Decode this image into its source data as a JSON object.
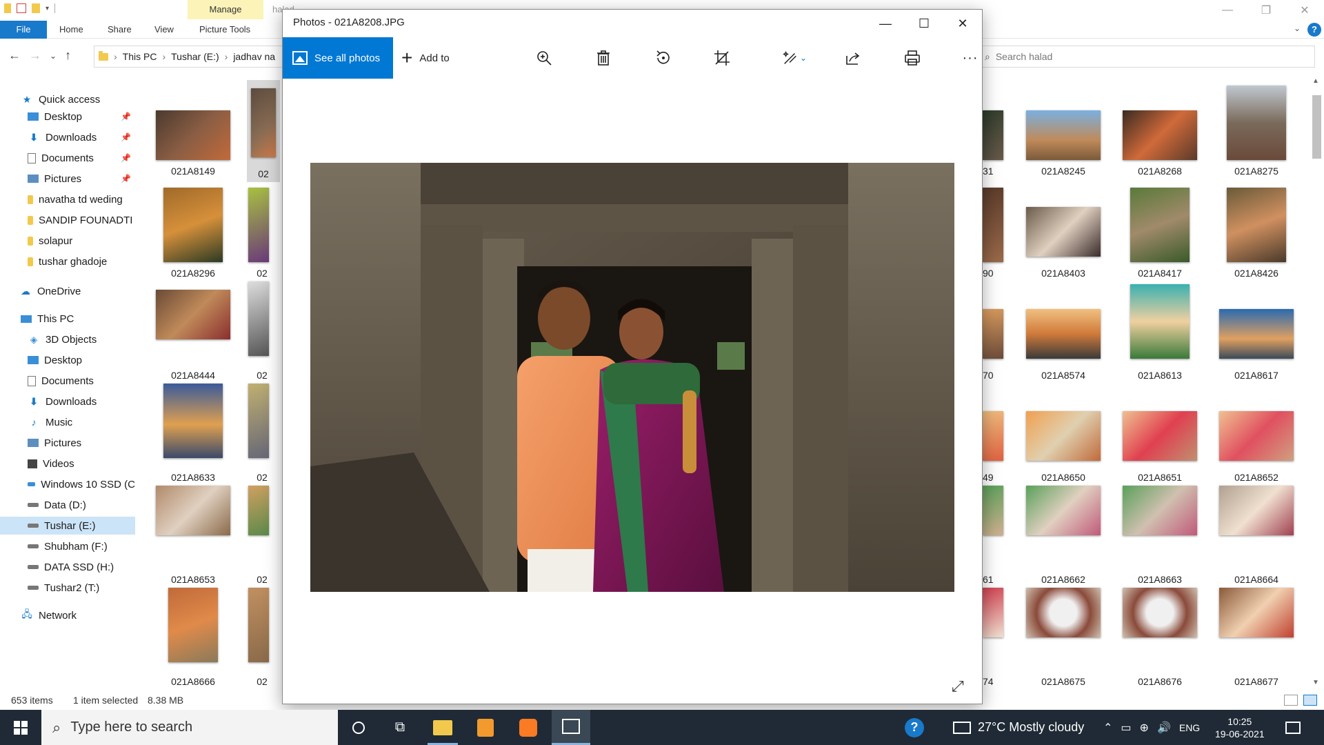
{
  "explorer": {
    "title": "halad",
    "context_tab": "Manage",
    "ribbon_tabs": [
      "File",
      "Home",
      "Share",
      "View",
      "Picture Tools"
    ],
    "help": "?",
    "breadcrumb": [
      "This PC",
      "Tushar (E:)",
      "jadhav na"
    ],
    "search_placeholder": "Search halad",
    "nav": {
      "quick_access": "Quick access",
      "quick_items": [
        "Desktop",
        "Downloads",
        "Documents",
        "Pictures",
        "navatha td weding",
        "SANDIP FOUNADTI",
        "solapur",
        "tushar ghadoje"
      ],
      "onedrive": "OneDrive",
      "this_pc": "This PC",
      "pc_items": [
        "3D Objects",
        "Desktop",
        "Documents",
        "Downloads",
        "Music",
        "Pictures",
        "Videos",
        "Windows 10 SSD (C",
        "Data (D:)",
        "Tushar (E:)",
        "Shubham (F:)",
        "DATA SSD (H:)",
        "Tushar2 (T:)"
      ],
      "network": "Network"
    },
    "left_thumbs": [
      [
        "021A8149",
        "02"
      ],
      [
        "021A8296",
        "02"
      ],
      [
        "021A8444",
        "02"
      ],
      [
        "021A8633",
        "02"
      ],
      [
        "021A8653",
        "02"
      ],
      [
        "021A8666",
        "02"
      ]
    ],
    "right_partial": [
      "31",
      "90",
      "70",
      "49",
      "61",
      "74"
    ],
    "right_thumbs": [
      [
        "021A8245",
        "021A8268",
        "021A8275"
      ],
      [
        "021A8403",
        "021A8417",
        "021A8426"
      ],
      [
        "021A8574",
        "021A8613",
        "021A8617"
      ],
      [
        "021A8650",
        "021A8651",
        "021A8652"
      ],
      [
        "021A8662",
        "021A8663",
        "021A8664"
      ],
      [
        "021A8675",
        "021A8676",
        "021A8677"
      ]
    ],
    "status": {
      "count": "653 items",
      "selected": "1 item selected",
      "size": "8.38 MB"
    }
  },
  "photos": {
    "title": "Photos - 021A8208.JPG",
    "see_all": "See all photos",
    "add_to": "Add to",
    "tools": [
      "zoom-in",
      "delete",
      "rotate",
      "crop",
      "edit",
      "share",
      "print",
      "more"
    ]
  },
  "taskbar": {
    "search_placeholder": "Type here to search",
    "weather": "27°C  Mostly cloudy",
    "lang": "ENG",
    "time": "10:25",
    "date": "19-06-2021"
  },
  "colors": {
    "accent": "#0078d4",
    "file_tab": "#1979ca",
    "manage_tab": "#fcf3b8",
    "taskbar": "#1f2a36",
    "selection": "#cce4f7"
  }
}
